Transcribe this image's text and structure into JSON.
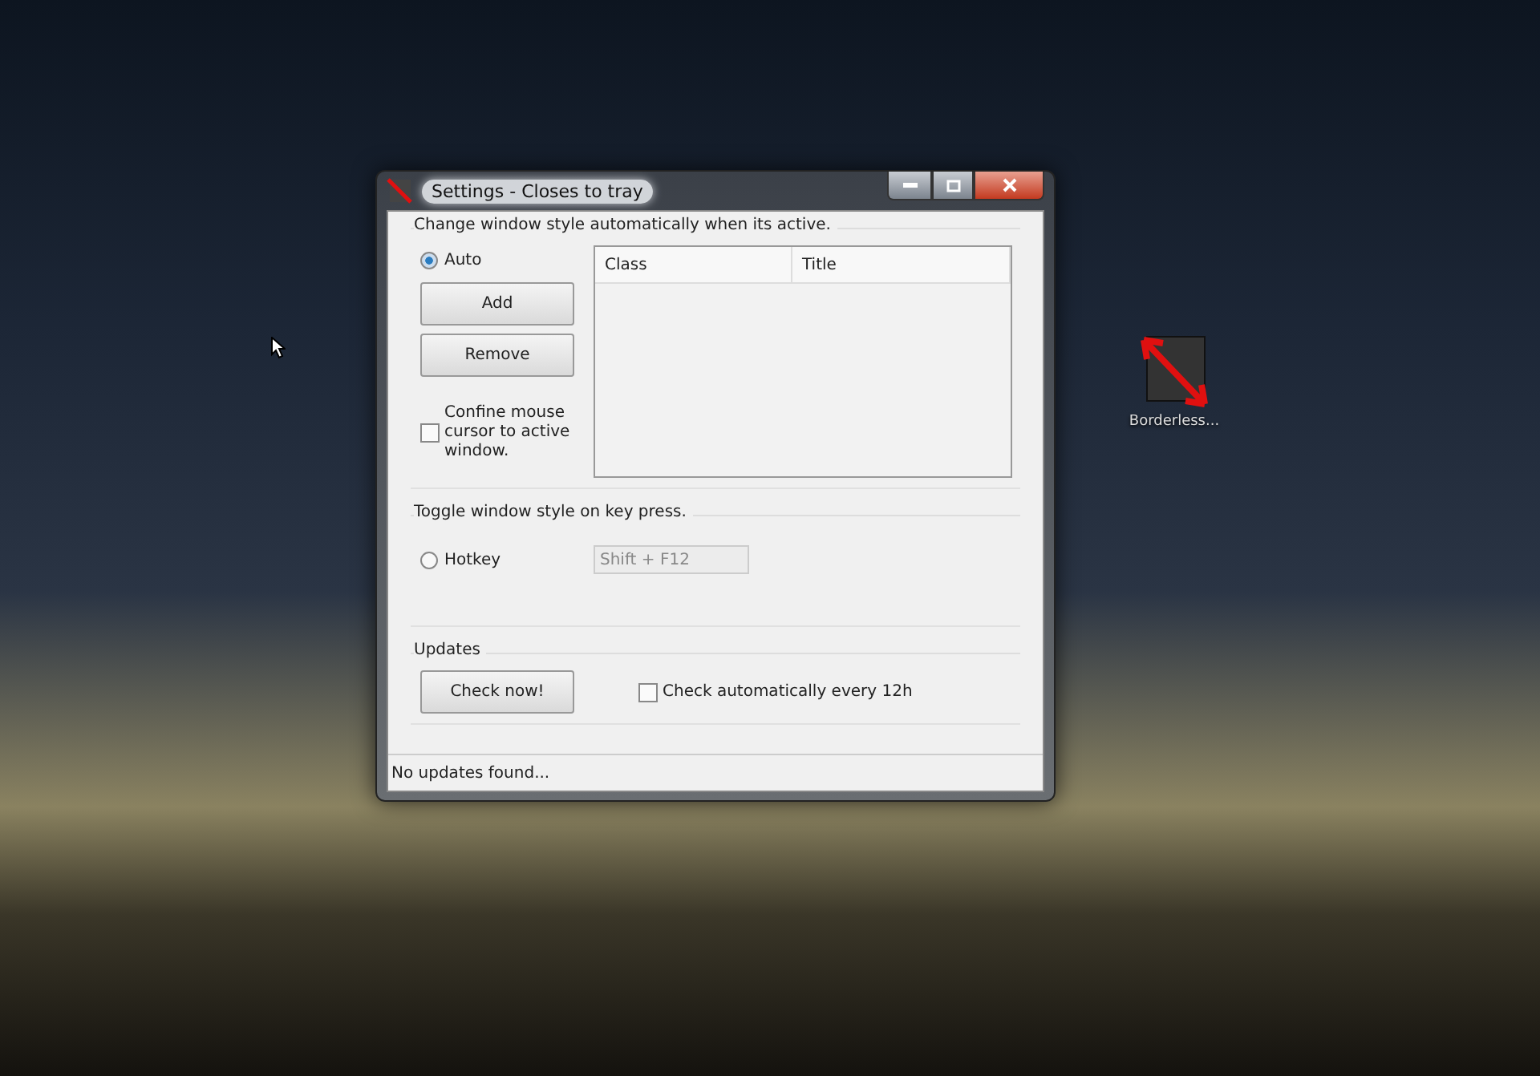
{
  "desktop_icons": [
    {
      "label": "Borderless..."
    }
  ],
  "window": {
    "title": "Settings - Closes to tray"
  },
  "auto_group": {
    "legend": "Change window style automatically when its active.",
    "radio": {
      "label": "Auto",
      "selected": true
    },
    "buttons": [
      "Add",
      "Remove"
    ],
    "confine": {
      "label": "Confine mouse cursor to active window.",
      "checked": false
    },
    "table": {
      "columns": [
        "Class",
        "Title"
      ]
    }
  },
  "hotkey_group": {
    "legend": "Toggle window style on key press.",
    "radio": {
      "label": "Hotkey",
      "selected": false
    },
    "field": {
      "value": "Shift + F12",
      "disabled": true
    }
  },
  "updates_group": {
    "legend": "Updates",
    "button": "Check now!",
    "auto_check": {
      "label": "Check automatically every 12h",
      "checked": false
    }
  },
  "status_bar": "No updates found..."
}
